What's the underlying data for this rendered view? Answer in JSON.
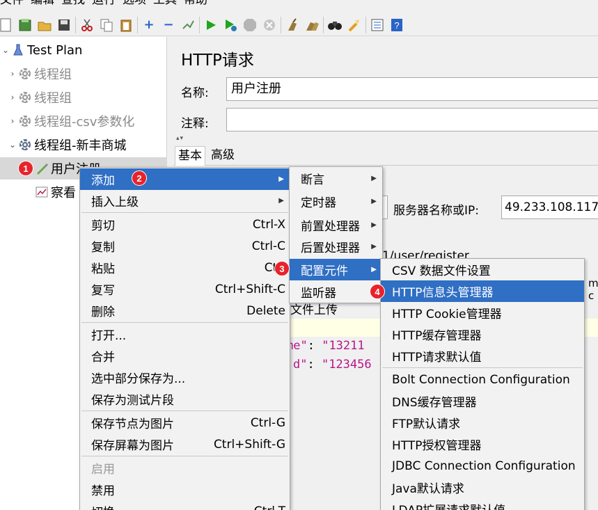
{
  "menubar": [
    "文件",
    "编辑",
    "查找",
    "运行",
    "选项",
    "工具",
    "帮助"
  ],
  "tree": {
    "root": "Test Plan",
    "items": [
      {
        "label": "线程组"
      },
      {
        "label": "线程组"
      },
      {
        "label": "线程组-csv参数化"
      },
      {
        "label": "线程组-新丰商城"
      },
      {
        "label": "用户注册"
      },
      {
        "label": "察看"
      }
    ]
  },
  "panel": {
    "title": "HTTP请求",
    "name_label": "名称:",
    "name_value": "用户注册",
    "comment_label": "注释:",
    "tab_basic": "基本",
    "tab_advanced": "高级",
    "server_label": "服务器名称或IP:",
    "server_value": "49.233.108.117",
    "path_text": "1/user/register",
    "file_upload": "文件上传",
    "json_line1_key": "me\"",
    "json_line1_val": "\"13211",
    "json_line2_key": "d\"",
    "json_line2_val": "\"123456",
    "cut_text": "m-c"
  },
  "context_menu": {
    "items": [
      {
        "label": "添加"
      },
      {
        "label": "插入上级"
      },
      {
        "label": "剪切",
        "shortcut": "Ctrl-X"
      },
      {
        "label": "复制",
        "shortcut": "Ctrl-C"
      },
      {
        "label": "粘贴",
        "shortcut": "Ctrl"
      },
      {
        "label": "复写",
        "shortcut": "Ctrl+Shift-C"
      },
      {
        "label": "删除",
        "shortcut": "Delete"
      },
      {
        "label": "打开..."
      },
      {
        "label": "合并"
      },
      {
        "label": "选中部分保存为..."
      },
      {
        "label": "保存为测试片段"
      },
      {
        "label": "保存节点为图片",
        "shortcut": "Ctrl-G"
      },
      {
        "label": "保存屏幕为图片",
        "shortcut": "Ctrl+Shift-G"
      },
      {
        "label": "启用"
      },
      {
        "label": "禁用"
      },
      {
        "label": "切换",
        "shortcut": "Ctrl-T"
      }
    ]
  },
  "add_submenu": {
    "items": [
      "断言",
      "定时器",
      "前置处理器",
      "后置处理器",
      "配置元件",
      "监听器"
    ]
  },
  "config_submenu": {
    "items": [
      "CSV 数据文件设置",
      "HTTP信息头管理器",
      "HTTP Cookie管理器",
      "HTTP缓存管理器",
      "HTTP请求默认值",
      "Bolt Connection Configuration",
      "DNS缓存管理器",
      "FTP默认请求",
      "HTTP授权管理器",
      "JDBC Connection Configuration",
      "Java默认请求",
      "LDAP扩展请求默认值"
    ]
  },
  "badges": [
    "1",
    "2",
    "3",
    "4"
  ],
  "colors": {
    "highlight": "#2f6fc4",
    "badge": "#e8232b",
    "json": "#b8158b"
  },
  "toolbar_icons": [
    "new-icon",
    "templates-icon",
    "open-icon",
    "save-icon",
    "cut-icon",
    "copy-icon",
    "paste-icon",
    "expand-icon",
    "collapse-icon",
    "toggle-icon",
    "start-icon",
    "start-no-pause-icon",
    "stop-icon",
    "shutdown-icon",
    "clear-icon",
    "clear-all-icon",
    "search-icon",
    "reset-search-icon",
    "function-helper-icon",
    "help-icon"
  ]
}
